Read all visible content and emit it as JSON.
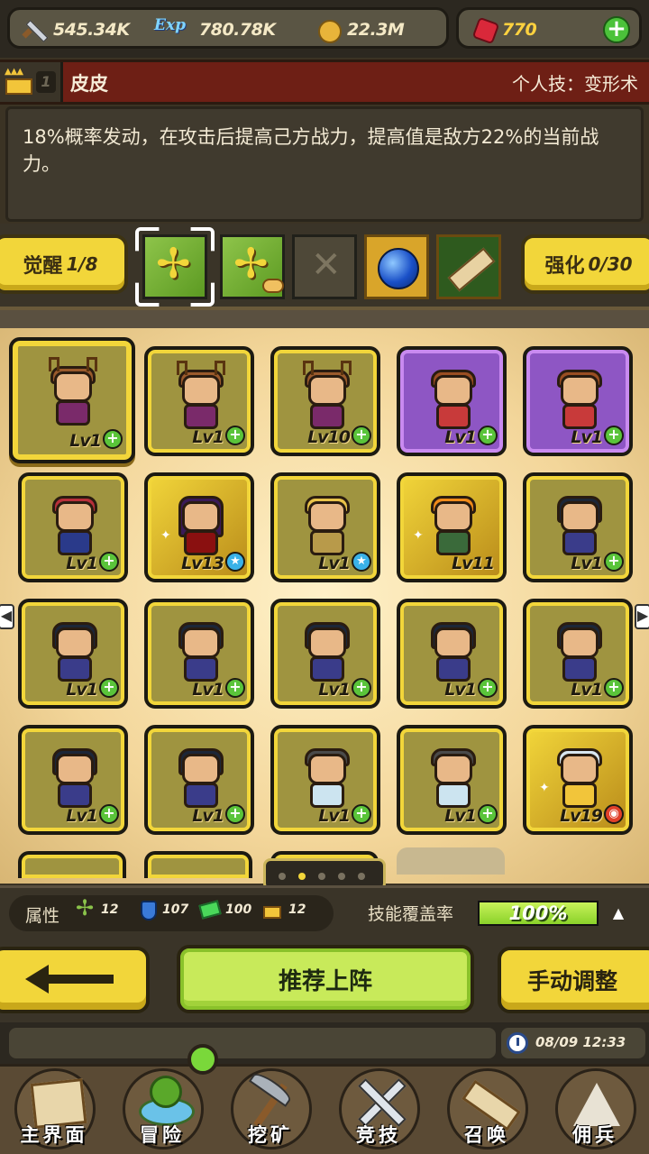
{
  "resources": {
    "power": "545.34K",
    "exp_label": "Exp",
    "exp": "780.78K",
    "gold": "22.3M",
    "gems": "770"
  },
  "character": {
    "rank": "1",
    "name": "皮皮",
    "skill_type": "个人技：变形术",
    "description": "18%概率发动，在攻击后提高己方战力，提高值是敌方22%的当前战力。"
  },
  "equip": {
    "awaken_label": "觉醒",
    "awaken_value": "1/8",
    "enhance_label": "强化",
    "enhance_value": "0/30",
    "slots": [
      "tree-icon",
      "tree-hand-icon",
      "empty-x-icon",
      "blue-orb-icon",
      "scroll-icon"
    ]
  },
  "heroes": [
    {
      "level": "Lv1",
      "badge": "plus"
    },
    {
      "level": "Lv1",
      "badge": "plus"
    },
    {
      "level": "Lv10",
      "badge": "plus"
    },
    {
      "level": "Lv1",
      "badge": "plus"
    },
    {
      "level": "Lv1",
      "badge": "plus"
    },
    {
      "level": "Lv1",
      "badge": "plus"
    },
    {
      "level": "Lv13",
      "badge": "star"
    },
    {
      "level": "Lv1",
      "badge": "star"
    },
    {
      "level": "Lv11",
      "badge": "none"
    },
    {
      "level": "Lv1",
      "badge": "plus"
    },
    {
      "level": "Lv1",
      "badge": "plus"
    },
    {
      "level": "Lv1",
      "badge": "plus"
    },
    {
      "level": "Lv1",
      "badge": "plus"
    },
    {
      "level": "Lv1",
      "badge": "plus"
    },
    {
      "level": "Lv1",
      "badge": "plus"
    },
    {
      "level": "Lv1",
      "badge": "plus"
    },
    {
      "level": "Lv1",
      "badge": "plus"
    },
    {
      "level": "Lv1",
      "badge": "plus"
    },
    {
      "level": "Lv1",
      "badge": "plus"
    },
    {
      "level": "Lv19",
      "badge": "red"
    }
  ],
  "pager": {
    "pages": 5,
    "current": 2
  },
  "stats": {
    "attr_label": "属性",
    "tree": "12",
    "shield": "107",
    "gem": "100",
    "crown": "12",
    "coverage_label": "技能覆盖率",
    "coverage_value": "100%",
    "coverage_fraction": 1.0
  },
  "actions": {
    "recommend": "推荐上阵",
    "manual": "手动调整"
  },
  "status": {
    "clock": "08/09 12:33"
  },
  "nav": [
    {
      "label": "主界面",
      "icon": "map-icon"
    },
    {
      "label": "冒险",
      "icon": "island-icon"
    },
    {
      "label": "挖矿",
      "icon": "pickaxe-icon"
    },
    {
      "label": "竞技",
      "icon": "crossed-swords-icon"
    },
    {
      "label": "召唤",
      "icon": "scroll-icon"
    },
    {
      "label": "佣兵",
      "icon": "tent-icon"
    }
  ],
  "colors": {
    "accent_yellow": "#f2d63a",
    "header_red": "#6e1f15",
    "coverage_green": "#8ad22a",
    "purple_rarity": "#8e56c4"
  }
}
